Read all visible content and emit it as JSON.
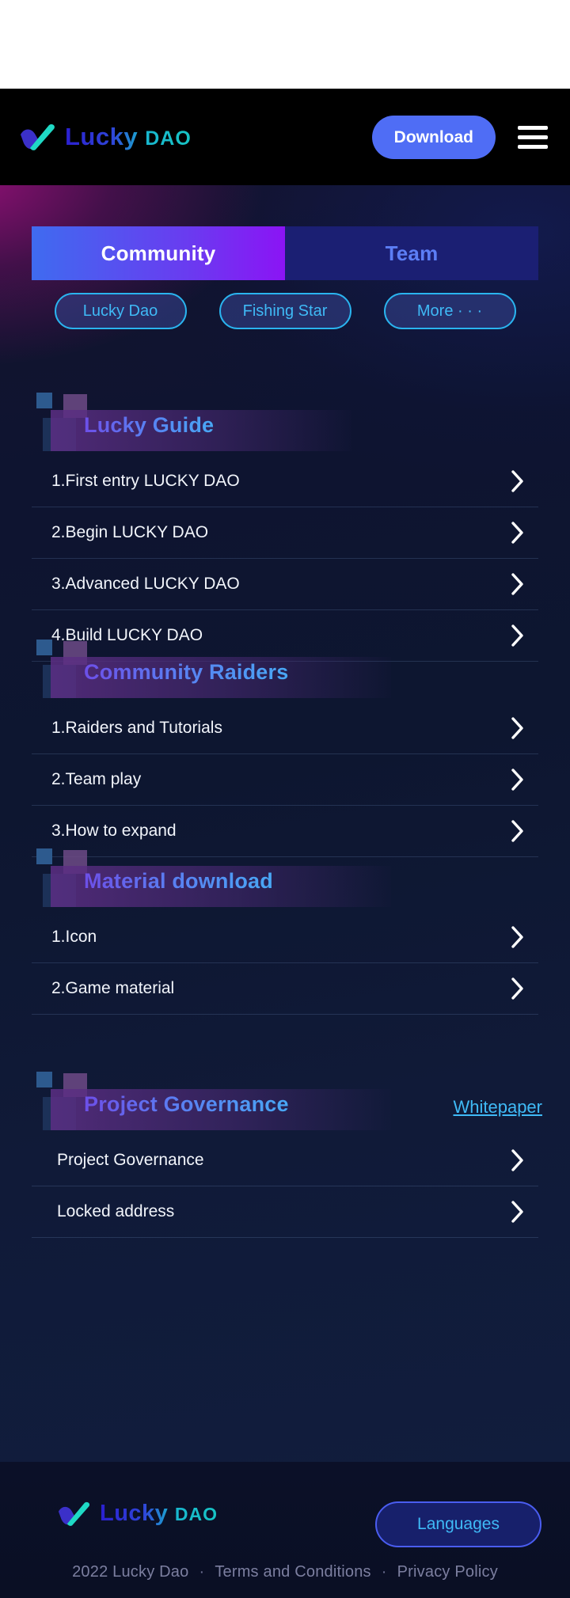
{
  "header": {
    "logo_text_main": "Lucky",
    "logo_text_dao": "DAO",
    "download_label": "Download",
    "menu_icon": "hamburger-menu-icon"
  },
  "tabs": [
    {
      "label": "Community",
      "active": true
    },
    {
      "label": "Team",
      "active": false
    }
  ],
  "filters": [
    {
      "label": "Lucky Dao"
    },
    {
      "label": "Fishing Star"
    },
    {
      "label": "More · · ·"
    }
  ],
  "sections": [
    {
      "title": "Lucky Guide",
      "link": null,
      "indent": false,
      "items": [
        {
          "label": "1.First entry LUCKY DAO"
        },
        {
          "label": "2.Begin LUCKY DAO"
        },
        {
          "label": "3.Advanced LUCKY DAO"
        },
        {
          "label": "4.Build LUCKY DAO"
        }
      ]
    },
    {
      "title": "Community Raiders",
      "link": null,
      "indent": false,
      "items": [
        {
          "label": "1.Raiders and Tutorials"
        },
        {
          "label": "2.Team play"
        },
        {
          "label": "3.How to expand"
        }
      ]
    },
    {
      "title": "Material download",
      "link": null,
      "indent": false,
      "items": [
        {
          "label": "1.Icon"
        },
        {
          "label": "2.Game material"
        }
      ]
    },
    {
      "title": "Project Governance",
      "link": "Whitepaper",
      "indent": true,
      "items": [
        {
          "label": "Project Governance"
        },
        {
          "label": "Locked address"
        }
      ]
    }
  ],
  "footer": {
    "logo_text_main": "Lucky",
    "logo_text_dao": "DAO",
    "languages_label": "Languages",
    "copyright": "2022 Lucky Dao",
    "terms": "Terms and Conditions",
    "privacy": "Privacy Policy",
    "separator": "·"
  },
  "colors": {
    "accent_blue": "#4f6df5",
    "accent_cyan": "#3fbaf6",
    "tab_gradient_start": "#3f6bf0",
    "tab_gradient_end": "#8b14f5",
    "tab_inactive_bg": "#1b1f73",
    "header_bg": "#000000",
    "footer_bg": "#0b1028"
  }
}
